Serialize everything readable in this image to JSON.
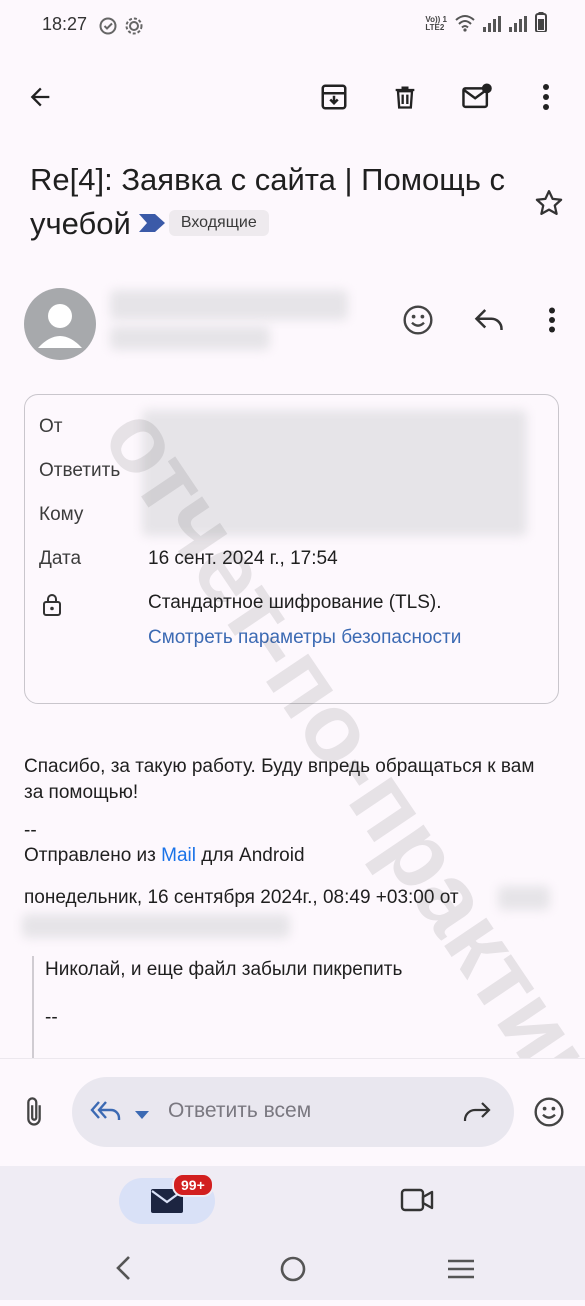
{
  "status_bar": {
    "time": "18:27",
    "network": "LTE2"
  },
  "toolbar": {
    "icons": [
      "back-arrow-icon",
      "archive-icon",
      "delete-icon",
      "mark-unread-icon",
      "more-vert-icon"
    ]
  },
  "email": {
    "subject": "Re[4]: Заявка с сайта | Помощь с учебой",
    "label": "Входящие"
  },
  "details": {
    "from_label": "От",
    "reply_to_label": "Ответить",
    "to_label": "Кому",
    "date_label": "Дата",
    "date_value": "16 сент. 2024 г., 17:54",
    "encryption": "Стандартное шифрование (TLS).",
    "security_link": "Смотреть параметры безопасности"
  },
  "body": {
    "line1": "Спасибо, за такую работу. Буду впредь обращаться к вам за помощью!",
    "sig_dash": "--",
    "sent_from_prefix": "Отправлено из ",
    "sent_from_link": "Mail",
    "sent_from_suffix": " для Android",
    "quote_header": "понедельник, 16 сентября 2024г., 08:49 +03:00 от",
    "quoted_text": "Николай, и еще файл забыли пикрепить",
    "quoted_dash": "--"
  },
  "reply_bar": {
    "placeholder": "Ответить всем"
  },
  "bottom_nav": {
    "badge": "99+"
  },
  "watermark": "отчет-по-практике.рф",
  "colors": {
    "link": "#3c6ab3",
    "mail_link": "#1a73e8",
    "badge": "#d21f1f",
    "accent": "#3c6ab3"
  }
}
